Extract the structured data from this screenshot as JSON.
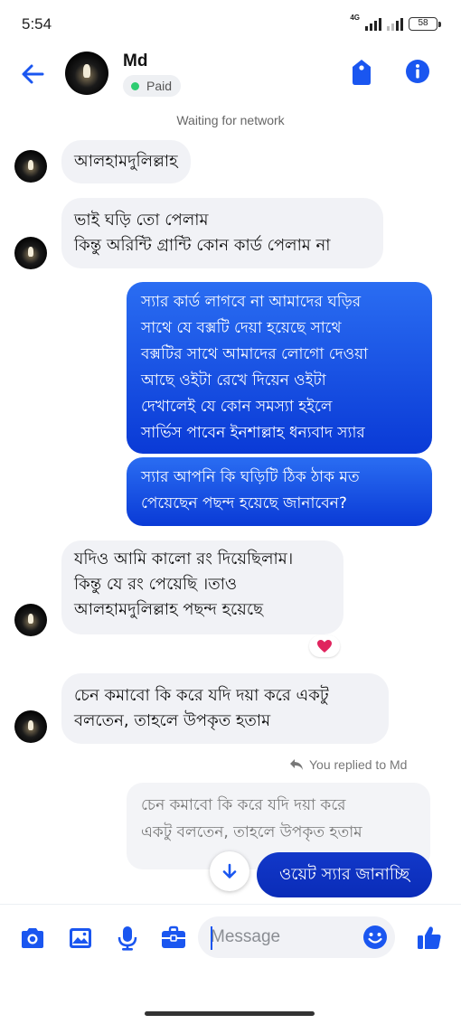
{
  "status_bar": {
    "time": "5:54",
    "network_type": "4G",
    "battery": "58"
  },
  "header": {
    "contact_name": "Md",
    "badge": "Paid",
    "badge_color": "#2ecc71",
    "icons": [
      "back-arrow-icon",
      "label-tag-icon",
      "info-icon"
    ]
  },
  "network_status": "Waiting for network",
  "messages": [
    {
      "direction": "incoming",
      "text_lines": [
        "আলহামদুলিল্লাহ"
      ]
    },
    {
      "direction": "incoming",
      "text_lines": [
        "ভাই ঘড়ি তো পেলাম",
        "কিন্তু অরিন্টি গ্রান্টি কোন কার্ড পেলাম না"
      ]
    },
    {
      "direction": "outgoing",
      "text_lines": [
        "স্যার কার্ড লাগবে না আমাদের ঘড়ির",
        "সাথে যে বক্সটি দেয়া হয়েছে সাথে",
        "বক্সটির সাথে আমাদের লোগো দেওয়া",
        "আছে ওইটা রেখে দিয়েন ওইটা",
        "দেখালেই যে কোন সমস্যা হইলে",
        "সার্ভিস পাবেন ইনশাল্লাহ ধন্যবাদ স্যার"
      ]
    },
    {
      "direction": "outgoing",
      "text_lines": [
        "স্যার আপনি কি ঘড়িটি ঠিক ঠাক মত",
        "পেয়েছেন পছন্দ হয়েছে জানাবেন?"
      ]
    },
    {
      "direction": "incoming",
      "text_lines": [
        "যদিও আমি কালো রং দিয়েছিলাম।",
        "কিন্তু যে রং পেয়েছি ।তাও",
        "আলহামদুলিল্লাহ পছন্দ হয়েছে"
      ],
      "reaction": "heart"
    },
    {
      "direction": "incoming",
      "text_lines": [
        "চেন কমাবো কি করে যদি দয়া করে একটু",
        "বলতেন, তাহলে উপকৃত হতাম"
      ]
    }
  ],
  "reply": {
    "note": "You replied to Md",
    "quoted_lines": [
      "চেন কমাবো কি করে যদি দয়া করে",
      "একটু বলতেন, তাহলে উপকৃত হতাম"
    ],
    "text": "ওয়েট স্যার জানাচ্ছি"
  },
  "composer": {
    "placeholder": "Message",
    "icons": [
      "camera-icon",
      "image-icon",
      "microphone-icon",
      "briefcase-icon",
      "emoji-icon",
      "thumbs-up-icon"
    ]
  },
  "colors": {
    "accent": "#1a56f0",
    "outgoing_bubble": "#0a3ad6",
    "incoming_bubble": "#f1f2f6"
  }
}
